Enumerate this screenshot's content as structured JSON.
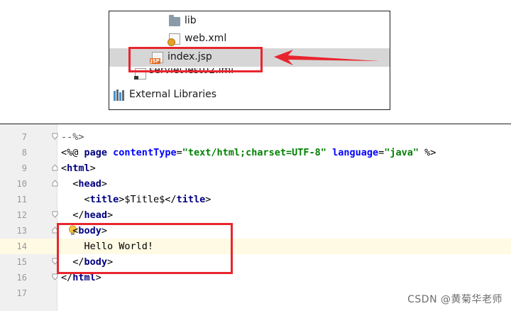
{
  "project_tree": {
    "items": [
      {
        "label": "lib",
        "icon": "folder-icon"
      },
      {
        "label": "web.xml",
        "icon": "xml-file-icon"
      },
      {
        "label": "index.jsp",
        "icon": "jsp-file-icon",
        "selected": true
      },
      {
        "label": "servletTest02.iml",
        "icon": "iml-file-icon"
      },
      {
        "label": "External Libraries",
        "icon": "libraries-icon"
      }
    ],
    "jsp_badge": "JSP"
  },
  "editor": {
    "lines": [
      {
        "no": "7",
        "code": "--%>"
      },
      {
        "no": "8",
        "code": "<%@ page contentType=\"text/html;charset=UTF-8\" language=\"java\" %>"
      },
      {
        "no": "9",
        "code": "<html>"
      },
      {
        "no": "10",
        "code": "  <head>"
      },
      {
        "no": "11",
        "code": "    <title>$Title$</title>"
      },
      {
        "no": "12",
        "code": "  </head>"
      },
      {
        "no": "13",
        "code": "  <body>"
      },
      {
        "no": "14",
        "code": "    Hello World!"
      },
      {
        "no": "15",
        "code": "  </body>"
      },
      {
        "no": "16",
        "code": "</html>"
      },
      {
        "no": "17",
        "code": ""
      }
    ],
    "current_line": "14"
  },
  "watermark": "CSDN @黄菊华老师",
  "colors": {
    "highlight_border": "#e8252e",
    "arrow": "#e8252e",
    "tag": "#000080",
    "attribute": "#0000ff",
    "string": "#008000",
    "selection": "#d6d6d6",
    "current_line": "#fffae3"
  }
}
